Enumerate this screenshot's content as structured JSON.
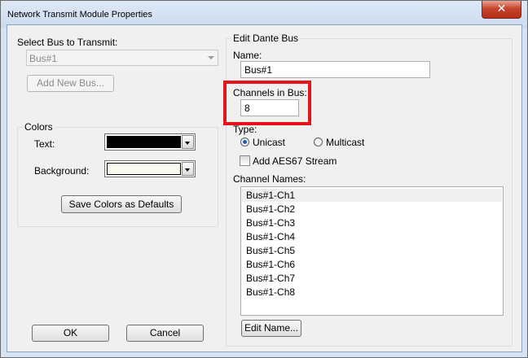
{
  "window": {
    "title": "Network Transmit Module Properties",
    "close_glyph": "✕"
  },
  "left": {
    "select_bus_label": "Select Bus to Transmit:",
    "bus_combo_value": "Bus#1",
    "add_bus_button": "Add New Bus...",
    "colors_group_title": "Colors",
    "text_label": "Text:",
    "background_label": "Background:",
    "text_color": "#000000",
    "background_color": "#fbfaef",
    "save_colors_button": "Save Colors as Defaults"
  },
  "right": {
    "group_title": "Edit Dante Bus",
    "name_label": "Name:",
    "name_value": "Bus#1",
    "channels_label": "Channels in Bus:",
    "channels_value": "8",
    "type_label": "Type:",
    "unicast_label": "Unicast",
    "multicast_label": "Multicast",
    "type_selected": "Unicast",
    "aes67_label": "Add AES67 Stream",
    "aes67_checked": false,
    "channel_names_label": "Channel Names:",
    "channel_names": [
      "Bus#1-Ch1",
      "Bus#1-Ch2",
      "Bus#1-Ch3",
      "Bus#1-Ch4",
      "Bus#1-Ch5",
      "Bus#1-Ch6",
      "Bus#1-Ch7",
      "Bus#1-Ch8"
    ],
    "edit_name_button": "Edit Name..."
  },
  "footer": {
    "ok_button": "OK",
    "cancel_button": "Cancel"
  },
  "colors": {
    "highlight": "#e3141b",
    "radio_selected": "#1d5bbf"
  }
}
